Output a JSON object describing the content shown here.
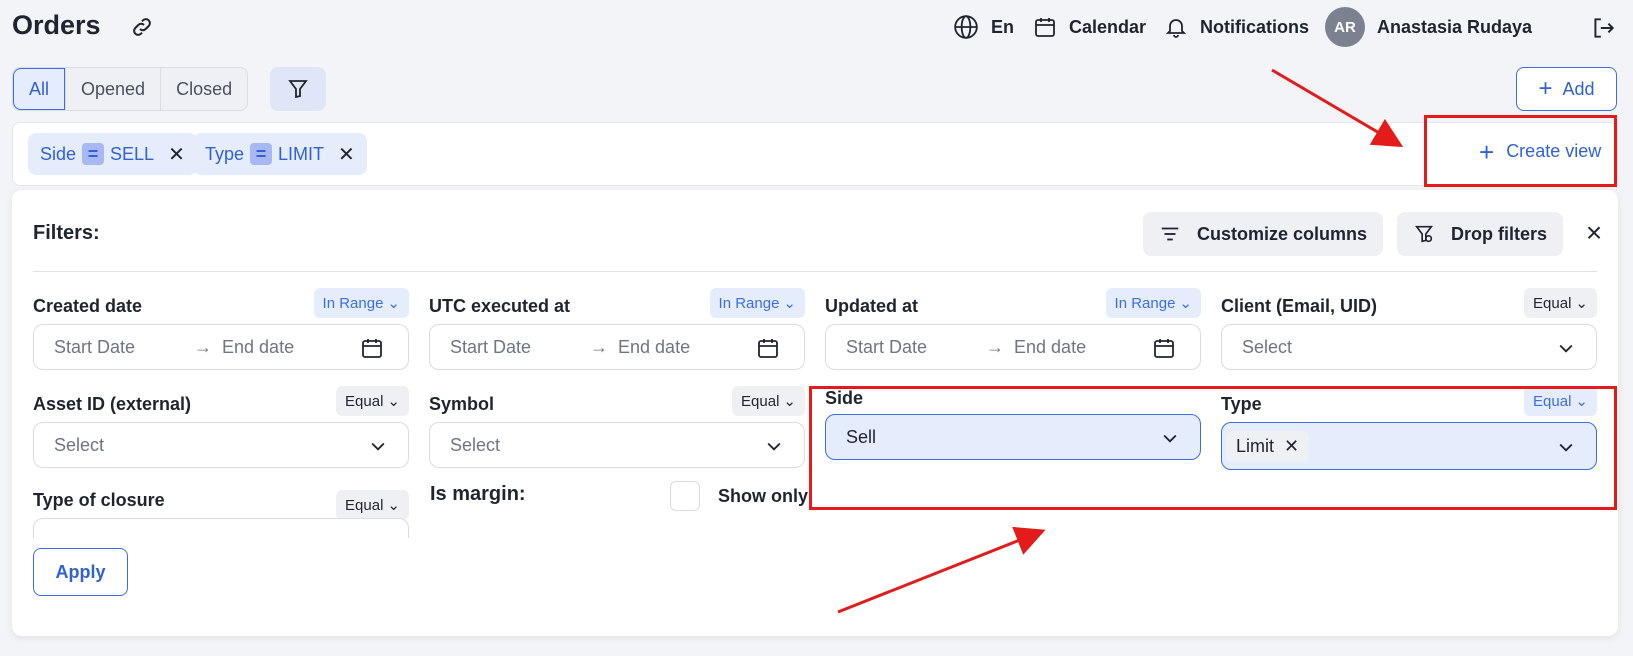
{
  "header": {
    "title": "Orders",
    "language": "En",
    "calendar": "Calendar",
    "notifications": "Notifications",
    "avatar_initials": "AR",
    "user_name": "Anastasia Rudaya"
  },
  "tabs": [
    {
      "label": "All",
      "active": true
    },
    {
      "label": "Opened",
      "active": false
    },
    {
      "label": "Closed",
      "active": false
    }
  ],
  "add_label": "Add",
  "chips": [
    {
      "field": "Side",
      "value": "SELL"
    },
    {
      "field": "Type",
      "value": "LIMIT"
    }
  ],
  "create_view_label": "Create view",
  "panel": {
    "title": "Filters:",
    "customize_columns": "Customize columns",
    "drop_filters": "Drop filters",
    "apply": "Apply"
  },
  "filters": {
    "created_date": {
      "label": "Created date",
      "op": "In Range",
      "start": "Start Date",
      "end": "End date"
    },
    "utc_executed_at": {
      "label": "UTC executed at",
      "op": "In Range",
      "start": "Start Date",
      "end": "End date"
    },
    "updated_at": {
      "label": "Updated at",
      "op": "In Range",
      "start": "Start Date",
      "end": "End date"
    },
    "client": {
      "label": "Client (Email, UID)",
      "op": "Equal",
      "placeholder": "Select"
    },
    "asset_id": {
      "label": "Asset ID (external)",
      "op": "Equal",
      "placeholder": "Select"
    },
    "symbol": {
      "label": "Symbol",
      "op": "Equal",
      "placeholder": "Select"
    },
    "side": {
      "label": "Side",
      "value": "Sell"
    },
    "type": {
      "label": "Type",
      "op": "Equal",
      "tag": "Limit"
    },
    "type_of_closure": {
      "label": "Type of closure",
      "op": "Equal"
    },
    "is_margin": {
      "label": "Is margin:",
      "checkbox_label": "Show only"
    }
  },
  "colors": {
    "accent": "#3b6fe0",
    "annotation": "#e41b1b"
  }
}
